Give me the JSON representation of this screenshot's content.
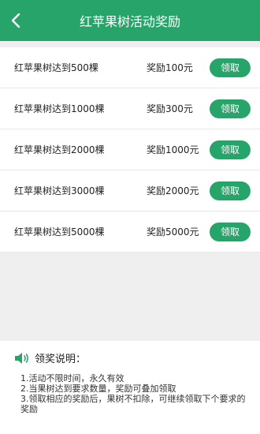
{
  "header": {
    "title": "红苹果树活动奖励"
  },
  "rewards": [
    {
      "label": "红苹果树达到500棵",
      "reward": "奖励100元",
      "button": "领取"
    },
    {
      "label": "红苹果树达到1000棵",
      "reward": "奖励300元",
      "button": "领取"
    },
    {
      "label": "红苹果树达到2000棵",
      "reward": "奖励1000元",
      "button": "领取"
    },
    {
      "label": "红苹果树达到3000棵",
      "reward": "奖励2000元",
      "button": "领取"
    },
    {
      "label": "红苹果树达到5000棵",
      "reward": "奖励5000元",
      "button": "领取"
    }
  ],
  "notes": {
    "title": "领奖说明：",
    "items": [
      "1.活动不限时间，永久有效",
      "2.当果树达到要求数量，奖励可叠加领取",
      "3.领取相应的奖励后，果树不扣除，可继续领取下个要求的奖励"
    ]
  },
  "colors": {
    "accent": "#27a469",
    "background": "#efefef"
  }
}
